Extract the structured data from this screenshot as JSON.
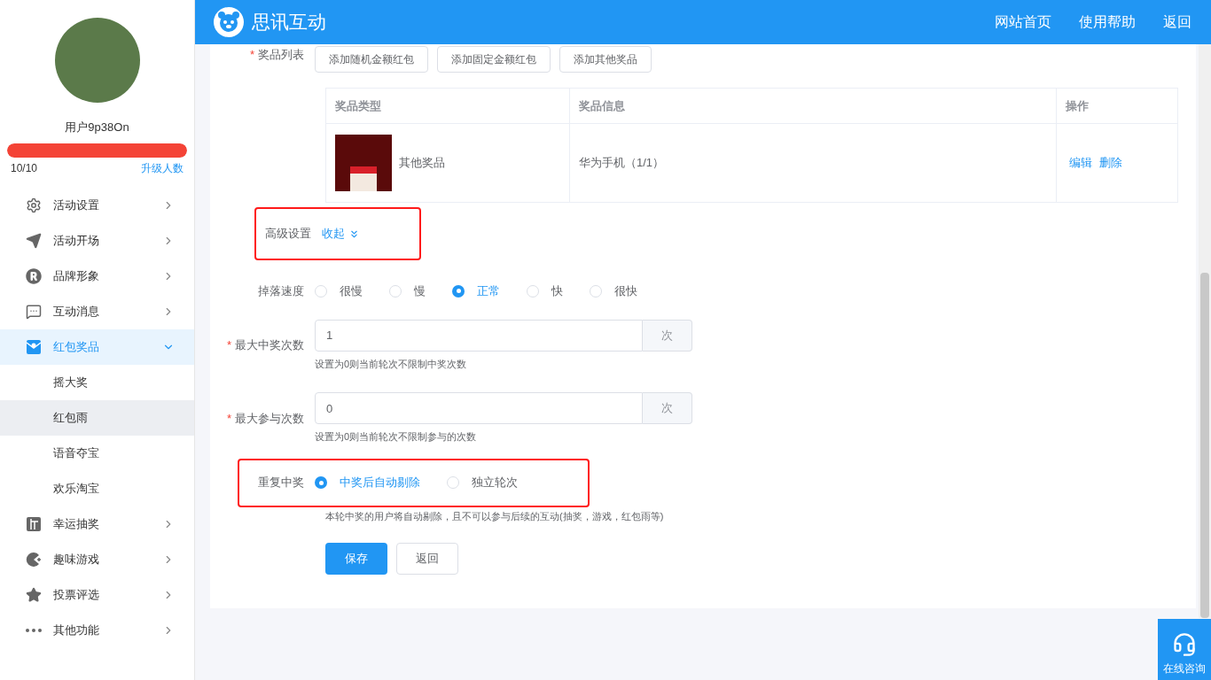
{
  "header": {
    "brand": "思讯互动",
    "links": [
      "网站首页",
      "使用帮助",
      "返回"
    ]
  },
  "sidebar": {
    "username": "用户9p38On",
    "quota": {
      "level": 1,
      "count": "10/10",
      "upgrade": "升级人数"
    },
    "items": [
      {
        "label": "活动设置",
        "expanded": false,
        "selected": false
      },
      {
        "label": "活动开场",
        "expanded": false,
        "selected": false
      },
      {
        "label": "品牌形象",
        "expanded": false,
        "selected": false
      },
      {
        "label": "互动消息",
        "expanded": false,
        "selected": false
      },
      {
        "label": "红包奖品",
        "expanded": true,
        "selected": true,
        "children": [
          {
            "label": "摇大奖",
            "selected": false
          },
          {
            "label": "红包雨",
            "selected": true
          },
          {
            "label": "语音夺宝",
            "selected": false
          },
          {
            "label": "欢乐淘宝",
            "selected": false
          }
        ]
      },
      {
        "label": "幸运抽奖",
        "expanded": false,
        "selected": false
      },
      {
        "label": "趣味游戏",
        "expanded": false,
        "selected": false
      },
      {
        "label": "投票评选",
        "expanded": false,
        "selected": false
      },
      {
        "label": "其他功能",
        "expanded": false,
        "selected": false
      }
    ]
  },
  "form": {
    "prize_list": {
      "label": "奖品列表",
      "required_mark": "*",
      "buttons": [
        "添加随机金额红包",
        "添加固定金额红包",
        "添加其他奖品"
      ],
      "table": {
        "columns": [
          "奖品类型",
          "奖品信息",
          "操作"
        ],
        "rows": [
          {
            "type": "其他奖品",
            "info": "华为手机（1/1）",
            "actions": [
              "编辑",
              "删除"
            ]
          }
        ]
      }
    },
    "advanced": {
      "label": "高级设置",
      "toggle": "收起",
      "highlighted": true
    },
    "drop_speed": {
      "label": "掉落速度",
      "options": [
        {
          "label": "很慢",
          "selected": false
        },
        {
          "label": "慢",
          "selected": false
        },
        {
          "label": "正常",
          "selected": true
        },
        {
          "label": "快",
          "selected": false
        },
        {
          "label": "很快",
          "selected": false
        }
      ]
    },
    "max_wins": {
      "label": "最大中奖次数",
      "required_mark": "*",
      "value": "1",
      "unit": "次",
      "hint": "设置为0则当前轮次不限制中奖次数"
    },
    "max_joins": {
      "label": "最大参与次数",
      "required_mark": "*",
      "value": "0",
      "unit": "次",
      "hint": "设置为0则当前轮次不限制参与的次数"
    },
    "repeat_win": {
      "label": "重复中奖",
      "highlighted": true,
      "options": [
        {
          "label": "中奖后自动剔除",
          "selected": true
        },
        {
          "label": "独立轮次",
          "selected": false
        }
      ],
      "hint": "本轮中奖的用户将自动剔除，且不可以参与后续的互动(抽奖，游戏，红包雨等)"
    },
    "save": "保存",
    "back": "返回"
  },
  "consult": "在线咨询"
}
